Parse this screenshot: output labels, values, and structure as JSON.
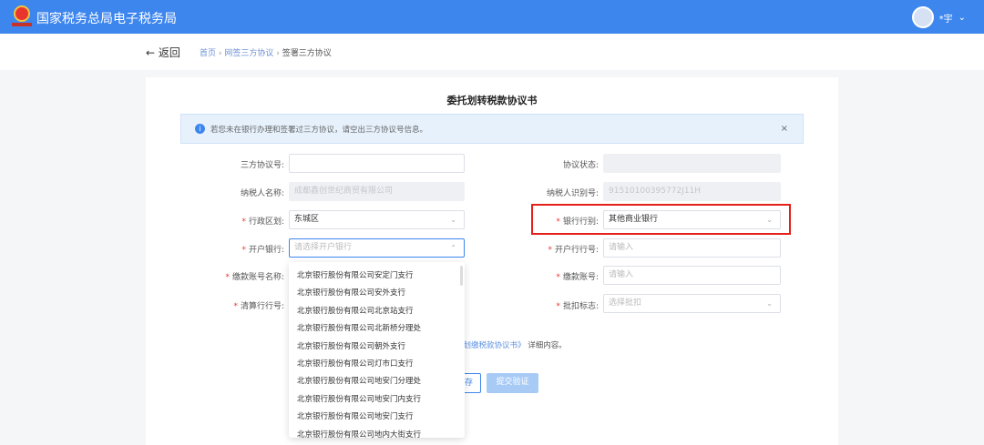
{
  "header": {
    "title": "国家税务总局电子税务局",
    "user": "*宇"
  },
  "nav": {
    "back": "返回",
    "crumbs": [
      "首页",
      "网签三方协议",
      "签署三方协议"
    ]
  },
  "form": {
    "title": "委托划转税款协议书",
    "alert": "若您未在银行办理和签署过三方协议，请空出三方协议号信息。",
    "fields": {
      "agreement_no": {
        "label": "三方协议号:",
        "value": ""
      },
      "status": {
        "label": "协议状态:",
        "value": ""
      },
      "taxpayer_name": {
        "label": "纳税人名称:",
        "value": "成都鑫创世纪商贸有限公司"
      },
      "taxpayer_id": {
        "label": "纳税人识别号:",
        "value": "91510100395772J11H"
      },
      "district": {
        "label": "行政区划:",
        "value": "东城区"
      },
      "bank_type": {
        "label": "银行行别:",
        "value": "其他商业银行"
      },
      "bank": {
        "label": "开户银行:",
        "placeholder": "请选择开户银行"
      },
      "bank_no": {
        "label": "开户行行号:",
        "placeholder": "请输入"
      },
      "account_name": {
        "label": "缴款账号名称:"
      },
      "account_no": {
        "label": "缴款账号:",
        "placeholder": "请输入"
      },
      "clearing_no": {
        "label": "清算行行号:"
      },
      "deduct_flag": {
        "label": "批扣标志:",
        "placeholder": "选择批扣"
      }
    },
    "bank_options": [
      "北京银行股份有限公司安定门支行",
      "北京银行股份有限公司安外支行",
      "北京银行股份有限公司北京站支行",
      "北京银行股份有限公司北新桥分理处",
      "北京银行股份有限公司朝外支行",
      "北京银行股份有限公司灯市口支行",
      "北京银行股份有限公司地安门分理处",
      "北京银行股份有限公司地安门内支行",
      "北京银行股份有限公司地安门支行",
      "北京银行股份有限公司地内大街支行"
    ],
    "note_link": "权划缴税款协议书》",
    "note_tail": "详细内容。",
    "save": "存",
    "submit": "提交验证"
  }
}
